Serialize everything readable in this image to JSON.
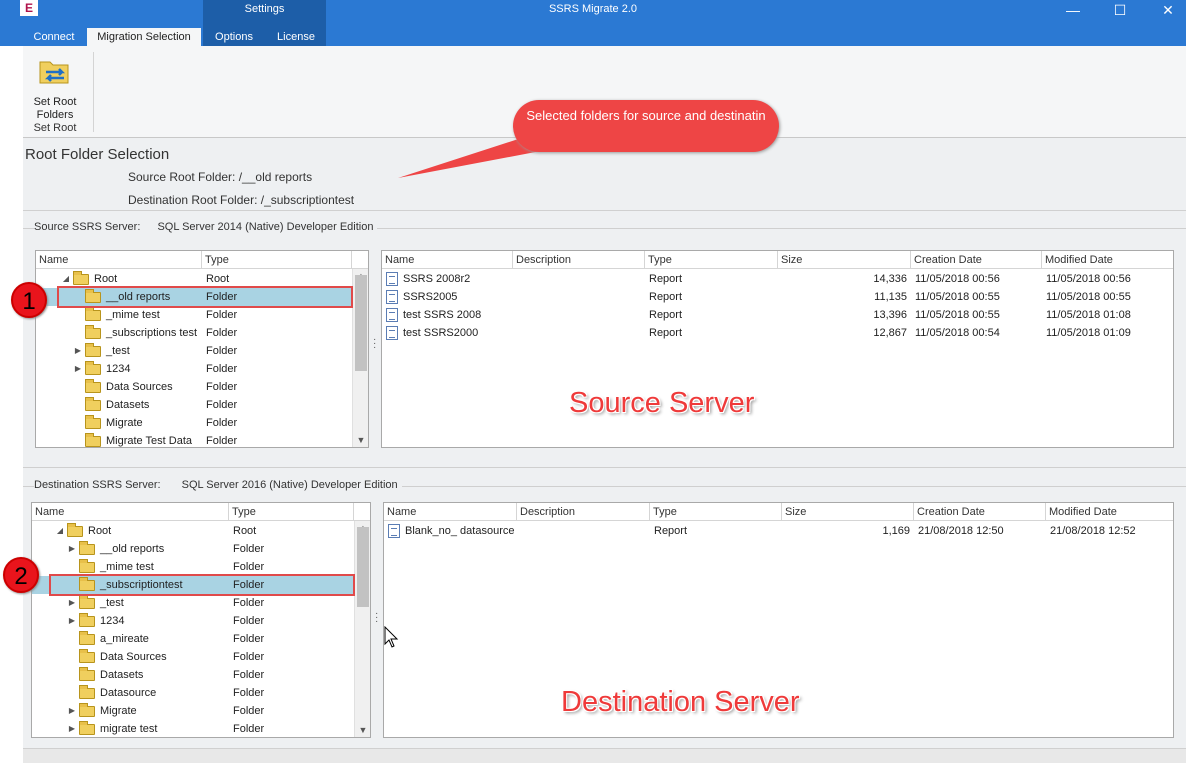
{
  "window": {
    "title": "SSRS Migrate 2.0",
    "app_icon": "E",
    "context_tab": "Settings",
    "minimize": "—",
    "maximize": "☐",
    "close": "✕"
  },
  "tabs": [
    "Connect",
    "Migration Selection",
    "Options",
    "License"
  ],
  "ribbon": {
    "button_label": "Set Root\nFolders",
    "group_label": "Set Root"
  },
  "root_selection": {
    "title": "Root Folder Selection",
    "source_line": "Source Root Folder: /__old reports",
    "dest_line": "Destination Root Folder: /_subscriptiontest"
  },
  "callout": "Selected folders for source and destinatin",
  "badges": [
    "1",
    "2"
  ],
  "source": {
    "caption_label": "Source SSRS Server:",
    "caption_value": "SQL Server 2014 (Native) Developer Edition",
    "tree_headers": [
      "Name",
      "Type"
    ],
    "tree": [
      {
        "name": "Root",
        "type": "Root",
        "level": 0,
        "exp": "open"
      },
      {
        "name": "__old reports",
        "type": "Folder",
        "level": 1,
        "exp": "",
        "sel": true
      },
      {
        "name": "_mime test",
        "type": "Folder",
        "level": 1,
        "exp": ""
      },
      {
        "name": "_subscriptions test",
        "type": "Folder",
        "level": 1,
        "exp": ""
      },
      {
        "name": "_test",
        "type": "Folder",
        "level": 1,
        "exp": "closed"
      },
      {
        "name": "1234",
        "type": "Folder",
        "level": 1,
        "exp": "closed"
      },
      {
        "name": "Data Sources",
        "type": "Folder",
        "level": 1,
        "exp": ""
      },
      {
        "name": "Datasets",
        "type": "Folder",
        "level": 1,
        "exp": ""
      },
      {
        "name": "Migrate",
        "type": "Folder",
        "level": 1,
        "exp": ""
      },
      {
        "name": "Migrate Test Data",
        "type": "Folder",
        "level": 1,
        "exp": ""
      }
    ],
    "list_headers": [
      "Name",
      "Description",
      "Type",
      "Size",
      "Creation Date",
      "Modified Date"
    ],
    "list": [
      {
        "name": "SSRS 2008r2",
        "desc": "",
        "type": "Report",
        "size": "14,336",
        "created": "11/05/2018 00:56",
        "modified": "11/05/2018 00:56"
      },
      {
        "name": "SSRS2005",
        "desc": "",
        "type": "Report",
        "size": "11,135",
        "created": "11/05/2018 00:55",
        "modified": "11/05/2018 00:55"
      },
      {
        "name": "test SSRS 2008",
        "desc": "",
        "type": "Report",
        "size": "13,396",
        "created": "11/05/2018 00:55",
        "modified": "11/05/2018 01:08"
      },
      {
        "name": "test SSRS2000",
        "desc": "",
        "type": "Report",
        "size": "12,867",
        "created": "11/05/2018 00:54",
        "modified": "11/05/2018 01:09"
      }
    ],
    "overlay_label": "Source Server"
  },
  "dest": {
    "caption_label": "Destination SSRS Server:",
    "caption_value": "SQL Server 2016 (Native) Developer Edition",
    "tree_headers": [
      "Name",
      "Type"
    ],
    "tree": [
      {
        "name": "Root",
        "type": "Root",
        "level": 0,
        "exp": "open"
      },
      {
        "name": "__old reports",
        "type": "Folder",
        "level": 1,
        "exp": "closed"
      },
      {
        "name": "_mime test",
        "type": "Folder",
        "level": 1,
        "exp": ""
      },
      {
        "name": "_subscriptiontest",
        "type": "Folder",
        "level": 1,
        "exp": "",
        "sel": true
      },
      {
        "name": "_test",
        "type": "Folder",
        "level": 1,
        "exp": "closed"
      },
      {
        "name": "1234",
        "type": "Folder",
        "level": 1,
        "exp": "closed"
      },
      {
        "name": "a_mireate",
        "type": "Folder",
        "level": 1,
        "exp": ""
      },
      {
        "name": "Data Sources",
        "type": "Folder",
        "level": 1,
        "exp": ""
      },
      {
        "name": "Datasets",
        "type": "Folder",
        "level": 1,
        "exp": ""
      },
      {
        "name": "Datasource",
        "type": "Folder",
        "level": 1,
        "exp": ""
      },
      {
        "name": "Migrate",
        "type": "Folder",
        "level": 1,
        "exp": "closed"
      },
      {
        "name": "migrate test",
        "type": "Folder",
        "level": 1,
        "exp": "closed"
      }
    ],
    "list_headers": [
      "Name",
      "Description",
      "Type",
      "Size",
      "Creation Date",
      "Modified Date"
    ],
    "list": [
      {
        "name": "Blank_no_ datasource",
        "desc": "",
        "type": "Report",
        "size": "1,169",
        "created": "21/08/2018 12:50",
        "modified": "21/08/2018 12:52"
      }
    ],
    "overlay_label": "Destination Server"
  }
}
